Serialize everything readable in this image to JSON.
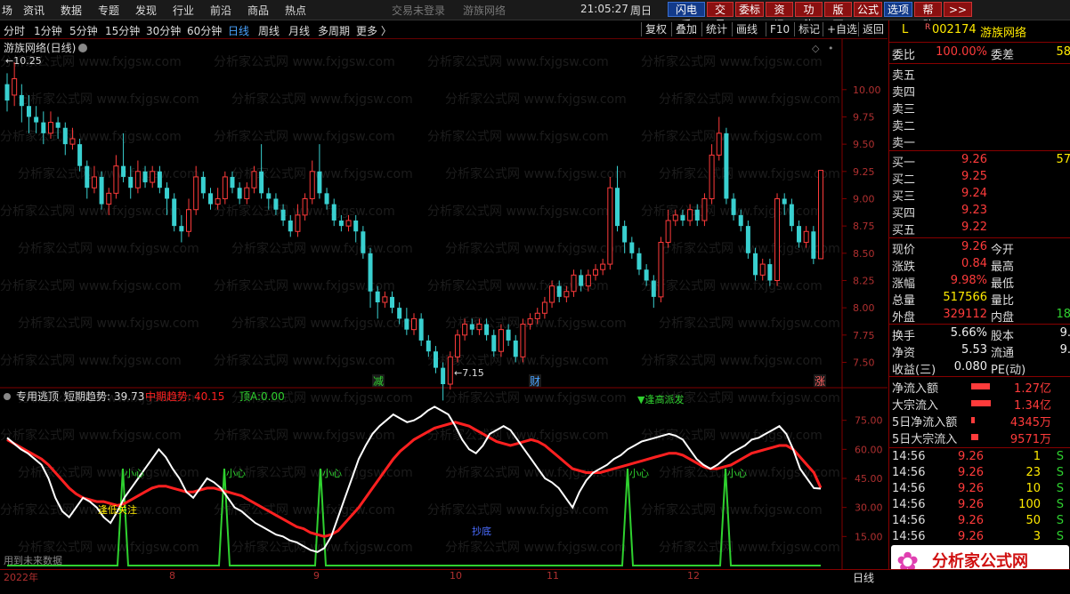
{
  "menubar": {
    "items": [
      "场",
      "资讯",
      "数据",
      "专题",
      "发现",
      "行业",
      "前沿",
      "商品",
      "热点"
    ],
    "center_status": "交易未登录",
    "center_brand": "游族网络",
    "clock": "21:05:27",
    "weekday": "周日",
    "buttons": [
      {
        "label": "闪电手",
        "style": "blue"
      },
      {
        "label": "交易",
        "style": "red"
      },
      {
        "label": "委标",
        "style": "red"
      },
      {
        "label": "资讯",
        "style": "red"
      },
      {
        "label": "功能",
        "style": "red"
      },
      {
        "label": "版面",
        "style": "red"
      },
      {
        "label": "公式",
        "style": "red"
      },
      {
        "label": "选项",
        "style": "blue"
      },
      {
        "label": "帮助",
        "style": "red"
      },
      {
        "label": ">>",
        "style": "red"
      }
    ]
  },
  "periods": {
    "items": [
      "分时",
      "1分钟",
      "5分钟",
      "15分钟",
      "30分钟",
      "60分钟",
      "日线",
      "周线",
      "月线",
      "多周期",
      "更多 〉"
    ],
    "active": "日线",
    "tools": [
      "复权",
      "叠加",
      "统计",
      "画线",
      "F10",
      "标记",
      "+自选",
      "返回"
    ]
  },
  "main_chart": {
    "title": "游族网络(日线)",
    "high_label": "10.25",
    "low_label": "7.15",
    "price_axis": [
      "10.00",
      "9.75",
      "9.50",
      "9.25",
      "9.00",
      "8.75",
      "8.50",
      "8.25",
      "8.00",
      "7.75",
      "7.50"
    ],
    "event_markers": [
      {
        "label": "减",
        "color": "#2fd12f"
      },
      {
        "label": "财",
        "color": "#4aa3ff"
      },
      {
        "label": "涨",
        "color": "#ff6060"
      }
    ]
  },
  "chart_data": [
    {
      "type": "candlestick",
      "title": "游族网络(日线)",
      "ylim": [
        7.3,
        10.3
      ],
      "y_ticks": [
        7.5,
        7.75,
        8.0,
        8.25,
        8.5,
        8.75,
        9.0,
        9.25,
        9.5,
        9.75,
        10.0
      ],
      "x_ticks": [
        "2022年",
        "8",
        "9",
        "10",
        "11",
        "12"
      ],
      "annotations": [
        "10.25",
        "7.15"
      ],
      "candles": [
        [
          10.05,
          9.9,
          10.15,
          9.8
        ],
        [
          9.95,
          10.1,
          10.25,
          9.85
        ],
        [
          9.95,
          9.85,
          10.05,
          9.7
        ],
        [
          9.85,
          9.75,
          9.95,
          9.6
        ],
        [
          9.75,
          9.7,
          9.85,
          9.6
        ],
        [
          9.7,
          9.6,
          9.8,
          9.5
        ],
        [
          9.6,
          9.7,
          9.8,
          9.55
        ],
        [
          9.7,
          9.65,
          9.75,
          9.55
        ],
        [
          9.65,
          9.5,
          9.7,
          9.4
        ],
        [
          9.5,
          9.55,
          9.65,
          9.45
        ],
        [
          9.5,
          9.3,
          9.55,
          9.25
        ],
        [
          9.3,
          9.1,
          9.35,
          9.0
        ],
        [
          9.1,
          9.2,
          9.3,
          9.05
        ],
        [
          9.2,
          8.95,
          9.25,
          8.9
        ],
        [
          8.95,
          9.05,
          9.1,
          8.85
        ],
        [
          9.05,
          9.3,
          9.4,
          9.0
        ],
        [
          9.3,
          9.2,
          9.6,
          9.15
        ],
        [
          9.2,
          9.1,
          9.3,
          9.0
        ],
        [
          9.1,
          9.25,
          9.35,
          9.05
        ],
        [
          9.25,
          9.15,
          9.3,
          9.1
        ],
        [
          9.15,
          9.25,
          9.3,
          9.1
        ],
        [
          9.25,
          9.1,
          9.3,
          9.05
        ],
        [
          9.1,
          9.0,
          9.15,
          8.85
        ],
        [
          9.0,
          8.75,
          9.05,
          8.7
        ],
        [
          8.75,
          8.7,
          8.85,
          8.6
        ],
        [
          8.7,
          8.9,
          9.0,
          8.65
        ],
        [
          8.9,
          9.2,
          9.3,
          8.85
        ],
        [
          9.2,
          9.05,
          9.25,
          9.0
        ],
        [
          9.05,
          8.95,
          9.1,
          8.9
        ],
        [
          8.95,
          9.0,
          9.1,
          8.9
        ],
        [
          9.0,
          9.2,
          9.25,
          8.95
        ],
        [
          9.2,
          9.1,
          9.25,
          9.05
        ],
        [
          9.1,
          9.0,
          9.15,
          8.95
        ],
        [
          9.0,
          9.1,
          9.15,
          8.95
        ],
        [
          9.1,
          9.25,
          9.3,
          9.05
        ],
        [
          9.25,
          9.05,
          9.5,
          9.0
        ],
        [
          9.05,
          9.0,
          9.1,
          8.9
        ],
        [
          9.0,
          8.9,
          9.05,
          8.85
        ],
        [
          8.9,
          8.8,
          8.95,
          8.75
        ],
        [
          8.8,
          8.7,
          8.85,
          8.65
        ],
        [
          8.7,
          8.85,
          8.95,
          8.65
        ],
        [
          8.85,
          9.0,
          9.05,
          8.8
        ],
        [
          9.0,
          9.25,
          9.35,
          8.95
        ],
        [
          9.25,
          9.05,
          9.5,
          9.0
        ],
        [
          9.05,
          8.95,
          9.1,
          8.9
        ],
        [
          8.95,
          8.8,
          9.0,
          8.75
        ],
        [
          8.8,
          8.75,
          8.85,
          8.7
        ],
        [
          8.75,
          8.8,
          8.85,
          8.7
        ],
        [
          8.8,
          8.7,
          8.85,
          8.6
        ],
        [
          8.7,
          8.5,
          8.75,
          8.45
        ],
        [
          8.5,
          8.15,
          8.55,
          8.0
        ],
        [
          8.15,
          8.05,
          8.2,
          7.9
        ],
        [
          8.05,
          8.1,
          8.15,
          8.0
        ],
        [
          8.1,
          8.0,
          8.15,
          7.95
        ],
        [
          8.0,
          7.9,
          8.05,
          7.85
        ],
        [
          7.9,
          7.8,
          8.0,
          7.75
        ],
        [
          7.8,
          7.9,
          7.95,
          7.75
        ],
        [
          7.9,
          7.7,
          7.95,
          7.65
        ],
        [
          7.7,
          7.6,
          7.75,
          7.55
        ],
        [
          7.6,
          7.45,
          7.65,
          7.4
        ],
        [
          7.45,
          7.3,
          7.5,
          7.15
        ],
        [
          7.3,
          7.55,
          7.6,
          7.25
        ],
        [
          7.55,
          7.75,
          7.8,
          7.5
        ],
        [
          7.75,
          7.85,
          7.9,
          7.7
        ],
        [
          7.85,
          7.8,
          7.9,
          7.75
        ],
        [
          7.8,
          7.85,
          7.9,
          7.75
        ],
        [
          7.85,
          7.75,
          7.9,
          7.7
        ],
        [
          7.75,
          7.6,
          7.8,
          7.55
        ],
        [
          7.6,
          7.8,
          7.85,
          7.55
        ],
        [
          7.8,
          7.7,
          7.85,
          7.65
        ],
        [
          7.7,
          7.55,
          7.75,
          7.5
        ],
        [
          7.55,
          7.85,
          7.9,
          7.5
        ],
        [
          7.85,
          7.9,
          7.95,
          7.8
        ],
        [
          7.9,
          7.95,
          8.0,
          7.85
        ],
        [
          7.95,
          8.05,
          8.1,
          7.9
        ],
        [
          8.05,
          8.2,
          8.25,
          8.0
        ],
        [
          8.2,
          8.1,
          8.25,
          8.05
        ],
        [
          8.1,
          8.15,
          8.2,
          8.05
        ],
        [
          8.15,
          8.3,
          8.35,
          8.1
        ],
        [
          8.3,
          8.2,
          8.35,
          8.15
        ],
        [
          8.2,
          8.3,
          8.35,
          8.15
        ],
        [
          8.3,
          8.35,
          8.4,
          8.25
        ],
        [
          8.35,
          8.4,
          8.45,
          8.3
        ],
        [
          8.4,
          9.1,
          9.2,
          8.35
        ],
        [
          9.1,
          8.75,
          9.3,
          8.7
        ],
        [
          8.75,
          8.6,
          8.8,
          8.5
        ],
        [
          8.6,
          8.5,
          8.65,
          8.45
        ],
        [
          8.5,
          8.35,
          8.55,
          8.3
        ],
        [
          8.35,
          8.25,
          8.4,
          8.2
        ],
        [
          8.25,
          8.1,
          8.3,
          8.0
        ],
        [
          8.1,
          8.6,
          8.65,
          8.05
        ],
        [
          8.6,
          8.8,
          8.9,
          8.55
        ],
        [
          8.8,
          8.85,
          8.9,
          8.75
        ],
        [
          8.85,
          8.8,
          8.9,
          8.75
        ],
        [
          8.8,
          8.9,
          8.95,
          8.75
        ],
        [
          8.9,
          8.8,
          8.95,
          8.75
        ],
        [
          8.8,
          9.0,
          9.05,
          8.75
        ],
        [
          9.0,
          9.4,
          9.5,
          8.95
        ],
        [
          9.4,
          9.6,
          9.75,
          9.35
        ],
        [
          9.6,
          9.0,
          9.65,
          8.95
        ],
        [
          9.0,
          8.85,
          9.05,
          8.8
        ],
        [
          8.85,
          8.75,
          8.9,
          8.7
        ],
        [
          8.75,
          8.5,
          8.8,
          8.45
        ],
        [
          8.5,
          8.3,
          8.55,
          8.25
        ],
        [
          8.3,
          8.4,
          8.45,
          8.25
        ],
        [
          8.4,
          8.25,
          8.45,
          8.2
        ],
        [
          8.25,
          9.0,
          9.05,
          8.2
        ],
        [
          9.0,
          8.95,
          9.05,
          8.85
        ],
        [
          8.95,
          8.75,
          9.0,
          8.7
        ],
        [
          8.75,
          8.6,
          8.8,
          8.55
        ],
        [
          8.6,
          8.7,
          8.75,
          8.55
        ],
        [
          8.7,
          8.45,
          8.75,
          8.4
        ],
        [
          8.45,
          9.26,
          9.26,
          8.45
        ]
      ]
    },
    {
      "type": "line",
      "title": "专用逃顶",
      "ylim": [
        0,
        90
      ],
      "y_ticks": [
        15.0,
        30.0,
        45.0,
        60.0,
        75.0
      ],
      "series": [
        {
          "name": "短期趋势",
          "color": "#ffffff",
          "values": [
            66,
            63,
            60,
            58,
            55,
            52,
            45,
            35,
            28,
            25,
            30,
            35,
            33,
            30,
            25,
            22,
            28,
            35,
            40,
            45,
            50,
            55,
            60,
            56,
            50,
            45,
            38,
            35,
            40,
            45,
            43,
            40,
            35,
            30,
            28,
            25,
            22,
            20,
            18,
            16,
            15,
            13,
            12,
            10,
            8,
            7,
            9,
            15,
            25,
            35,
            45,
            55,
            62,
            68,
            72,
            75,
            78,
            76,
            74,
            75,
            77,
            80,
            82,
            80,
            78,
            72,
            65,
            60,
            58,
            62,
            68,
            70,
            72,
            70,
            65,
            60,
            55,
            50,
            45,
            43,
            40,
            35,
            30,
            38,
            44,
            48,
            50,
            52,
            55,
            57,
            60,
            62,
            64,
            65,
            66,
            67,
            68,
            67,
            65,
            60,
            55,
            52,
            50,
            52,
            55,
            58,
            60,
            62,
            65,
            66,
            68,
            70,
            72,
            68,
            60,
            50,
            45,
            40,
            39.73
          ]
        },
        {
          "name": "中期趋势",
          "color": "#ff2020",
          "values": [
            65,
            63,
            61,
            59,
            57,
            55,
            52,
            48,
            44,
            40,
            37,
            35,
            34,
            33,
            33,
            32,
            31,
            32,
            34,
            36,
            38,
            40,
            41,
            41,
            40,
            39,
            38,
            38,
            39,
            40,
            40,
            39,
            38,
            37,
            36,
            34,
            32,
            30,
            28,
            26,
            24,
            22,
            20,
            19,
            17,
            16,
            15,
            16,
            18,
            22,
            26,
            30,
            35,
            40,
            45,
            50,
            55,
            59,
            62,
            65,
            67,
            69,
            71,
            72,
            73,
            74,
            73,
            72,
            70,
            68,
            66,
            64,
            63,
            62,
            63,
            64,
            65,
            64,
            62,
            59,
            56,
            53,
            50,
            49,
            48,
            48,
            48,
            49,
            50,
            51,
            52,
            53,
            54,
            55,
            56,
            57,
            58,
            58,
            57,
            55,
            53,
            51,
            50,
            50,
            51,
            52,
            54,
            56,
            58,
            59,
            60,
            61,
            62,
            62,
            60,
            56,
            52,
            48,
            40.15
          ]
        },
        {
          "name": "顶A",
          "color": "#2fd12f",
          "values": [
            0
          ]
        }
      ],
      "annotations": [
        "小心",
        "小心",
        "小心",
        "小心",
        "小心",
        "逢低关注",
        "逢高派发",
        "抄底"
      ]
    }
  ],
  "sub_chart": {
    "indicator": "专用逃顶",
    "short_label": "短期趋势:",
    "short_value": "39.73",
    "mid_label": "中期趋势:",
    "mid_value": "40.15",
    "top_label": "顶A:",
    "top_value": "0.00",
    "axis": [
      "75.00",
      "60.00",
      "45.00",
      "30.00",
      "15.00"
    ],
    "texts": {
      "caution": "小心",
      "buy_watch": "逢低关注",
      "sell_high": "▼逢高派发",
      "bottom": "抄底",
      "future_data": "用到未来数据"
    }
  },
  "x_axis": [
    "2022年",
    "8",
    "9",
    "10",
    "11",
    "12"
  ],
  "right_panel": {
    "code": "002174",
    "name": "游族网络",
    "flag_l": "L",
    "flag_r": "R",
    "wb_label": "委比",
    "wb_value": "100.00%",
    "wc_label": "委差",
    "wc_value": "58",
    "asks": [
      {
        "label": "卖五",
        "price": "",
        "vol": ""
      },
      {
        "label": "卖四",
        "price": "",
        "vol": ""
      },
      {
        "label": "卖三",
        "price": "",
        "vol": ""
      },
      {
        "label": "卖二",
        "price": "",
        "vol": ""
      },
      {
        "label": "卖一",
        "price": "",
        "vol": ""
      }
    ],
    "bids": [
      {
        "label": "买一",
        "price": "9.26",
        "vol": "57"
      },
      {
        "label": "买二",
        "price": "9.25",
        "vol": ""
      },
      {
        "label": "买三",
        "price": "9.24",
        "vol": ""
      },
      {
        "label": "买四",
        "price": "9.23",
        "vol": ""
      },
      {
        "label": "买五",
        "price": "9.22",
        "vol": ""
      }
    ],
    "stats": [
      {
        "l1": "现价",
        "v1": "9.26",
        "c1": "red",
        "l2": "今开",
        "v2": ""
      },
      {
        "l1": "涨跌",
        "v1": "0.84",
        "c1": "red",
        "l2": "最高",
        "v2": ""
      },
      {
        "l1": "涨幅",
        "v1": "9.98%",
        "c1": "red",
        "l2": "最低",
        "v2": ""
      },
      {
        "l1": "总量",
        "v1": "517566",
        "c1": "yellow",
        "l2": "量比",
        "v2": ""
      },
      {
        "l1": "外盘",
        "v1": "329112",
        "c1": "red",
        "l2": "内盘",
        "v2": "18"
      }
    ],
    "stats2": [
      {
        "l1": "换手",
        "v1": "5.66%",
        "l2": "股本",
        "v2": "9."
      },
      {
        "l1": "净资",
        "v1": "5.53",
        "l2": "流通",
        "v2": "9."
      },
      {
        "l1": "收益(三)",
        "v1": "0.080",
        "l2": "PE(动)",
        "v2": ""
      }
    ],
    "flows": [
      {
        "label": "净流入额",
        "value": "1.27亿",
        "bar": 0.7
      },
      {
        "label": "大宗流入",
        "value": "1.34亿",
        "bar": 0.74
      },
      {
        "label": "5日净流入额",
        "value": "4345万",
        "bar": 0.12
      },
      {
        "label": "5日大宗流入",
        "value": "9571万",
        "bar": 0.27
      }
    ],
    "ticks": [
      {
        "time": "14:56",
        "price": "9.26",
        "vol": "1",
        "side": "S"
      },
      {
        "time": "14:56",
        "price": "9.26",
        "vol": "23",
        "side": "S"
      },
      {
        "time": "14:56",
        "price": "9.26",
        "vol": "10",
        "side": "S"
      },
      {
        "time": "14:56",
        "price": "9.26",
        "vol": "100",
        "side": "S"
      },
      {
        "time": "14:56",
        "price": "9.26",
        "vol": "50",
        "side": "S"
      },
      {
        "time": "14:56",
        "price": "9.26",
        "vol": "3",
        "side": "S"
      }
    ],
    "logo_text": "分析家公式网",
    "logo_url_text": "www.fxjgsw.com"
  },
  "bottom": {
    "period_label": "日线"
  },
  "watermark": "分析家公式网 www.fxjgsw.com",
  "colors": {
    "up": "#ff3b3b",
    "down": "#39d0d0",
    "grid": "#800000",
    "short_line": "#ffffff",
    "mid_line": "#ff2020",
    "top_line": "#2fd12f"
  }
}
